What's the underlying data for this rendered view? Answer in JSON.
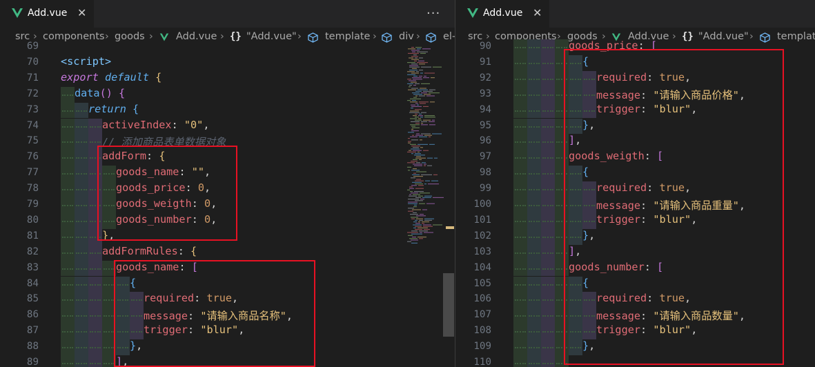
{
  "left_pane": {
    "tab": {
      "name": "Add.vue",
      "close": "✕"
    },
    "more": "···",
    "breadcrumbs": [
      "src",
      "components",
      "goods",
      "Add.vue",
      "{}",
      "\"Add.vue\"",
      "template",
      "div",
      "el-"
    ],
    "lines": [
      {
        "n": "69",
        "t": []
      },
      {
        "n": "70",
        "t": [
          [
            "tag",
            "<script>"
          ]
        ]
      },
      {
        "n": "71",
        "t": [
          [
            "kw",
            "export "
          ],
          [
            "kw2",
            "default "
          ],
          [
            "br",
            "{"
          ]
        ]
      },
      {
        "n": "72",
        "t": [
          [
            "fn",
            "data"
          ],
          [
            "pu",
            "() "
          ],
          [
            "pu",
            "{"
          ]
        ]
      },
      {
        "n": "73",
        "t": [
          [
            "kw2",
            "return "
          ],
          [
            "fn",
            "{"
          ]
        ]
      },
      {
        "n": "74",
        "t": [
          [
            "k",
            "activeIndex"
          ],
          [
            "p",
            ": "
          ],
          [
            "s",
            "\"0\""
          ],
          [
            "p",
            ","
          ]
        ]
      },
      {
        "n": "75",
        "t": [
          [
            "cm",
            "// 添加商品表单数据对象"
          ]
        ]
      },
      {
        "n": "76",
        "t": [
          [
            "k",
            "addForm"
          ],
          [
            "p",
            ": "
          ],
          [
            "br",
            "{"
          ]
        ]
      },
      {
        "n": "77",
        "t": [
          [
            "k",
            "goods_name"
          ],
          [
            "p",
            ": "
          ],
          [
            "s",
            "\"\""
          ],
          [
            "p",
            ","
          ]
        ]
      },
      {
        "n": "78",
        "t": [
          [
            "k",
            "goods_price"
          ],
          [
            "p",
            ": "
          ],
          [
            "n",
            "0"
          ],
          [
            "p",
            ","
          ]
        ]
      },
      {
        "n": "79",
        "t": [
          [
            "k",
            "goods_weigth"
          ],
          [
            "p",
            ": "
          ],
          [
            "n",
            "0"
          ],
          [
            "p",
            ","
          ]
        ]
      },
      {
        "n": "80",
        "t": [
          [
            "k",
            "goods_number"
          ],
          [
            "p",
            ": "
          ],
          [
            "n",
            "0"
          ],
          [
            "p",
            ","
          ]
        ]
      },
      {
        "n": "81",
        "t": [
          [
            "br",
            "}"
          ],
          [
            "p",
            ","
          ]
        ]
      },
      {
        "n": "82",
        "t": [
          [
            "k",
            "addFormRules"
          ],
          [
            "p",
            ": "
          ],
          [
            "br",
            "{"
          ]
        ]
      },
      {
        "n": "83",
        "t": [
          [
            "k",
            "goods_name"
          ],
          [
            "p",
            ": "
          ],
          [
            "pu",
            "["
          ]
        ]
      },
      {
        "n": "84",
        "t": [
          [
            "fn",
            "{"
          ]
        ]
      },
      {
        "n": "85",
        "t": [
          [
            "k",
            "required"
          ],
          [
            "p",
            ": "
          ],
          [
            "n",
            "true"
          ],
          [
            "p",
            ","
          ]
        ]
      },
      {
        "n": "86",
        "t": [
          [
            "k",
            "message"
          ],
          [
            "p",
            ": "
          ],
          [
            "s",
            "\"请输入商品名称\""
          ],
          [
            "p",
            ","
          ]
        ]
      },
      {
        "n": "87",
        "t": [
          [
            "k",
            "trigger"
          ],
          [
            "p",
            ": "
          ],
          [
            "s",
            "\"blur\""
          ],
          [
            "p",
            ","
          ]
        ]
      },
      {
        "n": "88",
        "t": [
          [
            "fn",
            "}"
          ],
          [
            "p",
            ","
          ]
        ]
      },
      {
        "n": "89",
        "t": [
          [
            "pu",
            "]"
          ],
          [
            "p",
            ","
          ]
        ]
      }
    ]
  },
  "right_pane": {
    "tab": {
      "name": "Add.vue",
      "close": "✕"
    },
    "breadcrumbs": [
      "src",
      "components",
      "goods",
      "Add.vue",
      "{}",
      "\"Add.vue\"",
      "template"
    ],
    "lines": [
      {
        "n": "90",
        "t": [
          [
            "k",
            "goods_price"
          ],
          [
            "p",
            ": "
          ],
          [
            "pu",
            "["
          ]
        ]
      },
      {
        "n": "91",
        "t": [
          [
            "fn",
            "{"
          ]
        ]
      },
      {
        "n": "92",
        "t": [
          [
            "k",
            "required"
          ],
          [
            "p",
            ": "
          ],
          [
            "n",
            "true"
          ],
          [
            "p",
            ","
          ]
        ]
      },
      {
        "n": "93",
        "t": [
          [
            "k",
            "message"
          ],
          [
            "p",
            ": "
          ],
          [
            "s",
            "\"请输入商品价格\""
          ],
          [
            "p",
            ","
          ]
        ]
      },
      {
        "n": "94",
        "t": [
          [
            "k",
            "trigger"
          ],
          [
            "p",
            ": "
          ],
          [
            "s",
            "\"blur\""
          ],
          [
            "p",
            ","
          ]
        ]
      },
      {
        "n": "95",
        "t": [
          [
            "fn",
            "}"
          ],
          [
            "p",
            ","
          ]
        ]
      },
      {
        "n": "96",
        "t": [
          [
            "pu",
            "]"
          ],
          [
            "p",
            ","
          ]
        ]
      },
      {
        "n": "97",
        "t": [
          [
            "k",
            "goods_weigth"
          ],
          [
            "p",
            ": "
          ],
          [
            "pu",
            "["
          ]
        ]
      },
      {
        "n": "98",
        "t": [
          [
            "fn",
            "{"
          ]
        ]
      },
      {
        "n": "99",
        "t": [
          [
            "k",
            "required"
          ],
          [
            "p",
            ": "
          ],
          [
            "n",
            "true"
          ],
          [
            "p",
            ","
          ]
        ]
      },
      {
        "n": "100",
        "t": [
          [
            "k",
            "message"
          ],
          [
            "p",
            ": "
          ],
          [
            "s",
            "\"请输入商品重量\""
          ],
          [
            "p",
            ","
          ]
        ]
      },
      {
        "n": "101",
        "t": [
          [
            "k",
            "trigger"
          ],
          [
            "p",
            ": "
          ],
          [
            "s",
            "\"blur\""
          ],
          [
            "p",
            ","
          ]
        ]
      },
      {
        "n": "102",
        "t": [
          [
            "fn",
            "}"
          ],
          [
            "p",
            ","
          ]
        ]
      },
      {
        "n": "103",
        "t": [
          [
            "pu",
            "]"
          ],
          [
            "p",
            ","
          ]
        ]
      },
      {
        "n": "104",
        "t": [
          [
            "k",
            "goods_number"
          ],
          [
            "p",
            ": "
          ],
          [
            "pu",
            "["
          ]
        ]
      },
      {
        "n": "105",
        "t": [
          [
            "fn",
            "{"
          ]
        ]
      },
      {
        "n": "106",
        "t": [
          [
            "k",
            "required"
          ],
          [
            "p",
            ": "
          ],
          [
            "n",
            "true"
          ],
          [
            "p",
            ","
          ]
        ]
      },
      {
        "n": "107",
        "t": [
          [
            "k",
            "message"
          ],
          [
            "p",
            ": "
          ],
          [
            "s",
            "\"请输入商品数量\""
          ],
          [
            "p",
            ","
          ]
        ]
      },
      {
        "n": "108",
        "t": [
          [
            "k",
            "trigger"
          ],
          [
            "p",
            ": "
          ],
          [
            "s",
            "\"blur\""
          ],
          [
            "p",
            ","
          ]
        ]
      },
      {
        "n": "109",
        "t": [
          [
            "fn",
            "}"
          ],
          [
            "p",
            ","
          ]
        ]
      },
      {
        "n": "110",
        "t": []
      }
    ]
  },
  "colors": {
    "vue_green": "#41b883",
    "highlight_box": "#e81123"
  }
}
